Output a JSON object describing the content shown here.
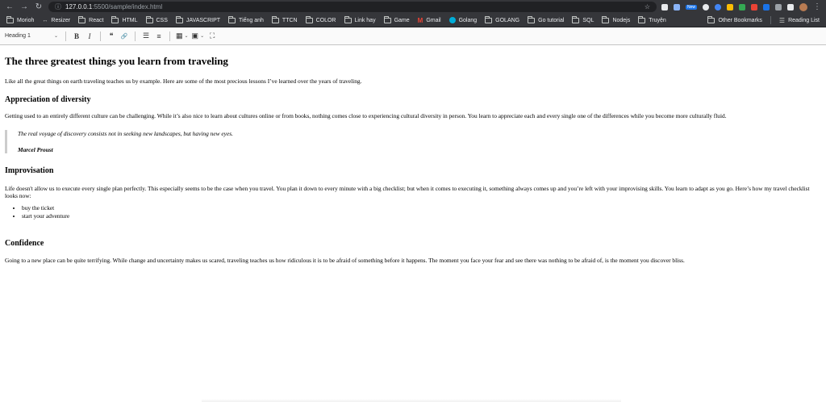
{
  "browser": {
    "nav": {
      "back": "←",
      "forward": "→",
      "reload": "↻"
    },
    "url": {
      "host": "127.0.0.1",
      "path": ":5500/sample/index.html"
    },
    "new_badge": "New"
  },
  "bookmarks": {
    "items": [
      {
        "label": "Morioh",
        "icon": "folder-icon"
      },
      {
        "label": "Resizer",
        "icon": "resizer-icon"
      },
      {
        "label": "React",
        "icon": "folder-icon"
      },
      {
        "label": "HTML",
        "icon": "folder-icon"
      },
      {
        "label": "CSS",
        "icon": "folder-icon"
      },
      {
        "label": "JAVASCRIPT",
        "icon": "folder-icon"
      },
      {
        "label": "Tiếng anh",
        "icon": "folder-icon"
      },
      {
        "label": "TTCN",
        "icon": "folder-icon"
      },
      {
        "label": "COLOR",
        "icon": "folder-icon"
      },
      {
        "label": "Link hay",
        "icon": "folder-icon"
      },
      {
        "label": "Game",
        "icon": "folder-icon"
      },
      {
        "label": "Gmail",
        "icon": "gmail-icon"
      },
      {
        "label": "Golang",
        "icon": "golang-icon"
      },
      {
        "label": "GOLANG",
        "icon": "folder-icon"
      },
      {
        "label": "Go tutorial",
        "icon": "folder-icon"
      },
      {
        "label": "SQL",
        "icon": "folder-icon"
      },
      {
        "label": "Nodejs",
        "icon": "folder-icon"
      },
      {
        "label": "Truyện",
        "icon": "folder-icon"
      }
    ],
    "other": "Other Bookmarks",
    "reading_list": "Reading List"
  },
  "toolbar": {
    "heading_select": "Heading 1",
    "bold": "B",
    "italic": "I",
    "blockquote": "❝",
    "link": "🔗",
    "bulleted_list": "☰",
    "numbered_list": "≡",
    "table": "▦",
    "image": "▣",
    "fullscreen": "⛶"
  },
  "article": {
    "title": "The three greatest things you learn from traveling",
    "intro": "Like all the great things on earth traveling teaches us by example. Here are some of the most precious lessons I’ve learned over the years of traveling.",
    "section1": {
      "heading": "Appreciation of diversity",
      "body": "Getting used to an entirely different culture can be challenging. While it’s also nice to learn about cultures online or from books, nothing comes close to experiencing cultural diversity in person. You learn to appreciate each and every single one of the differences while you become more culturally fluid."
    },
    "quote": {
      "text": "The real voyage of discovery consists not in seeking new landscapes, but having new eyes.",
      "author": "Marcel Proust"
    },
    "section2": {
      "heading": "Improvisation",
      "body": "Life doesn't allow us to execute every single plan perfectly. This especially seems to be the case when you travel. You plan it down to every minute with a big checklist; but when it comes to executing it, something always comes up and you’re left with your improvising skills. You learn to adapt as you go. Here’s how my travel checklist looks now:",
      "list": [
        "buy the ticket",
        "start your adventure"
      ]
    },
    "section3": {
      "heading": "Confidence",
      "body": "Going to a new place can be quite terrifying. While change and uncertainty makes us scared, traveling teaches us how ridiculous it is to be afraid of something before it happens. The moment you face your fear and see there was nothing to be afraid of, is the moment you discover bliss."
    }
  }
}
